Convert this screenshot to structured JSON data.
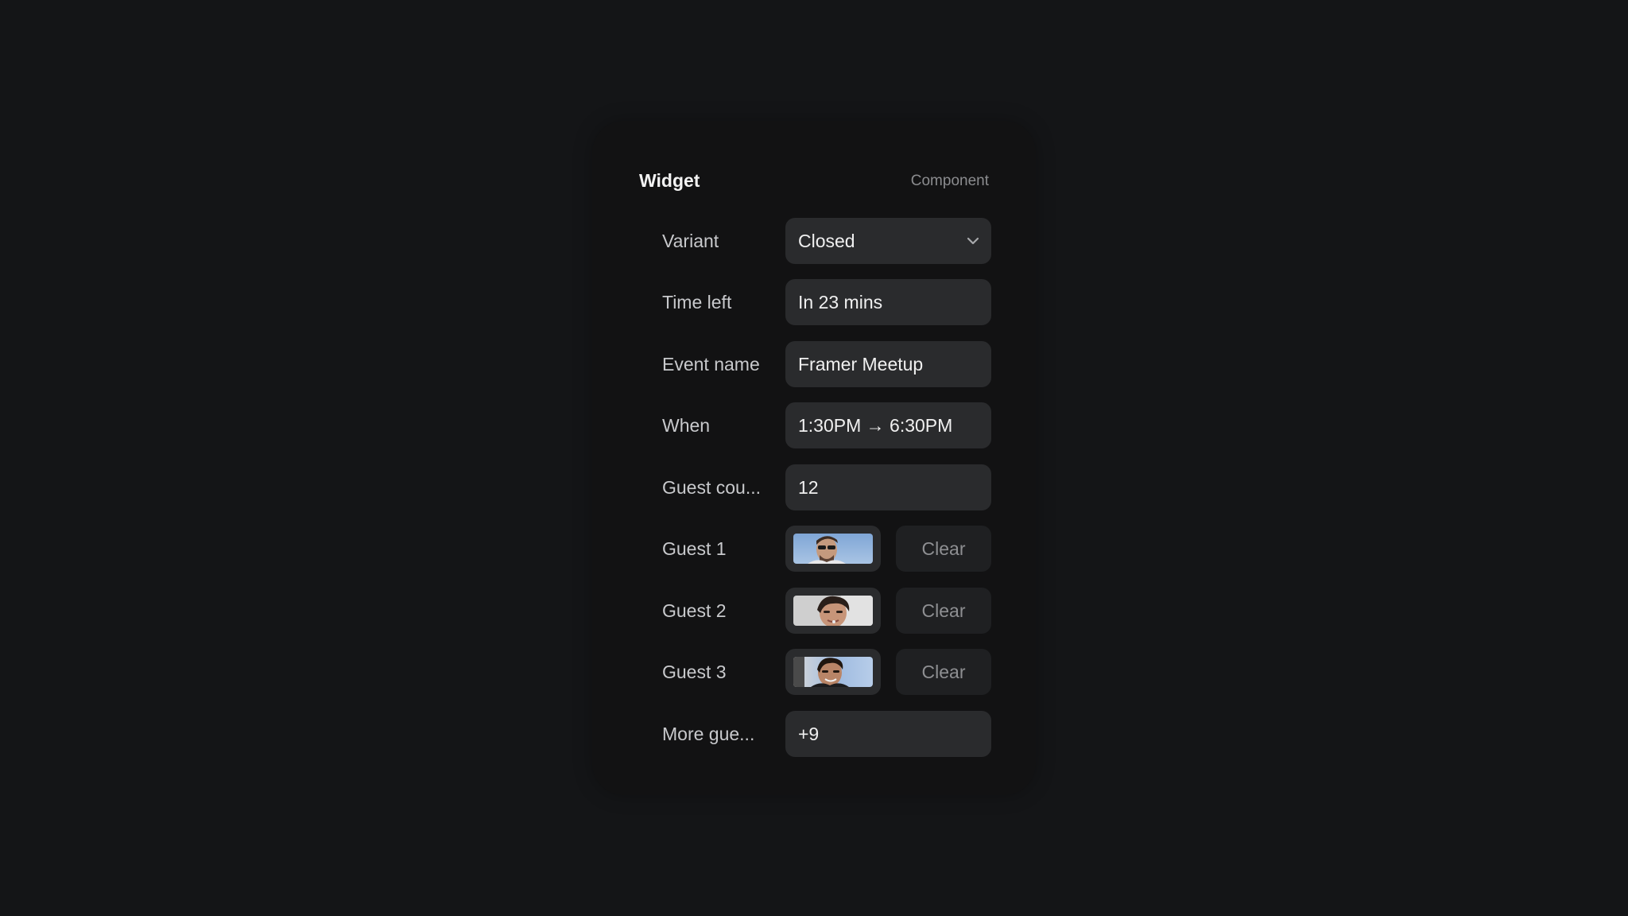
{
  "panel": {
    "title": "Widget",
    "type_label": "Component"
  },
  "properties": {
    "variant": {
      "label": "Variant",
      "value": "Closed",
      "control": "dropdown",
      "icon": "chevron-down-icon"
    },
    "time_left": {
      "label": "Time left",
      "value": "In 23 mins"
    },
    "event_name": {
      "label": "Event name",
      "value": "Framer Meetup"
    },
    "when": {
      "label": "When",
      "value": "1:30PM → 6:30PM"
    },
    "guest_count": {
      "label": "Guest cou...",
      "value": "12"
    },
    "guest_1": {
      "label": "Guest 1",
      "image": "guest-1-photo",
      "clear_label": "Clear"
    },
    "guest_2": {
      "label": "Guest 2",
      "image": "guest-2-photo",
      "clear_label": "Clear"
    },
    "guest_3": {
      "label": "Guest 3",
      "image": "guest-3-photo",
      "clear_label": "Clear"
    },
    "more_guests": {
      "label": "More gue...",
      "value": "+9"
    }
  },
  "colors": {
    "background": "#141517",
    "panel": "#121213",
    "field": "#2a2b2d",
    "button": "#1f2022"
  }
}
